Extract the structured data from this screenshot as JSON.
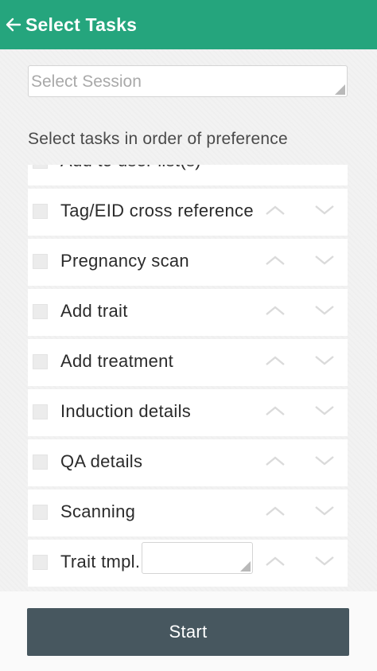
{
  "header": {
    "title": "Select Tasks",
    "back_icon": "arrow-left-icon",
    "color": "#25a57d"
  },
  "session": {
    "placeholder": "Select Session"
  },
  "instruction": "Select tasks in order of preference",
  "tasks": [
    {
      "label": "Add to user list(s)",
      "checked": false
    },
    {
      "label": "Tag/EID cross reference",
      "checked": false
    },
    {
      "label": "Pregnancy scan",
      "checked": false
    },
    {
      "label": "Add trait",
      "checked": false
    },
    {
      "label": "Add treatment",
      "checked": false
    },
    {
      "label": "Induction details",
      "checked": false
    },
    {
      "label": "QA details",
      "checked": false
    },
    {
      "label": "Scanning",
      "checked": false
    },
    {
      "label": "Trait tmpl.",
      "checked": false,
      "has_template_select": true
    }
  ],
  "footer": {
    "start_label": "Start",
    "button_color": "#47575f"
  }
}
